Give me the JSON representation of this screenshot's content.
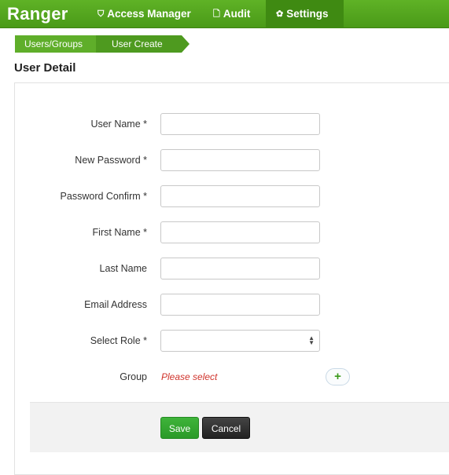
{
  "nav": {
    "brand": "Ranger",
    "items": [
      {
        "label": "Access Manager",
        "icon": "shield-icon",
        "glyph": "⛉"
      },
      {
        "label": "Audit",
        "icon": "file-icon",
        "glyph": "🗋"
      },
      {
        "label": "Settings",
        "icon": "gear-icon",
        "glyph": "✿",
        "active": true
      }
    ]
  },
  "breadcrumb": [
    "Users/Groups",
    "User Create"
  ],
  "page_title": "User Detail",
  "form": {
    "user_name": {
      "label": "User Name *",
      "value": ""
    },
    "new_password": {
      "label": "New Password *",
      "value": ""
    },
    "password_confirm": {
      "label": "Password Confirm *",
      "value": ""
    },
    "first_name": {
      "label": "First Name *",
      "value": ""
    },
    "last_name": {
      "label": "Last Name",
      "value": ""
    },
    "email": {
      "label": "Email Address",
      "value": ""
    },
    "role": {
      "label": "Select Role *",
      "value": ""
    },
    "group": {
      "label": "Group",
      "placeholder": "Please select",
      "add_glyph": "+"
    }
  },
  "buttons": {
    "save": "Save",
    "cancel": "Cancel"
  },
  "colors": {
    "brand_green": "#4a9a18",
    "save_green": "#2a9a28",
    "required_red": "#d0342c"
  }
}
